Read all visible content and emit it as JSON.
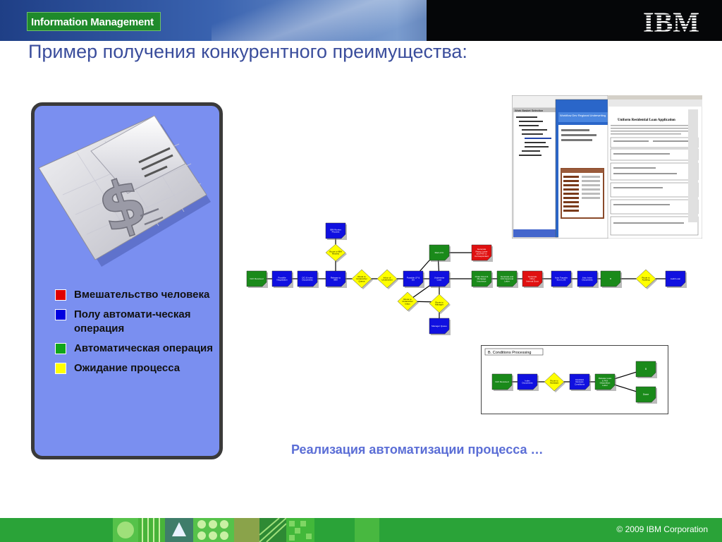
{
  "header": {
    "brand": "Information Management",
    "logo": "IBM"
  },
  "title": "Пример получения конкурентного преимущества:",
  "legend": [
    {
      "label": "Вмешательство человека",
      "color": "#e00000"
    },
    {
      "label": "Полу автомати-ческая операция",
      "color": "#0000e0"
    },
    {
      "label": "Автоматическая операция",
      "color": "#11a61a"
    },
    {
      "label": "Ожидание процесса",
      "color": "#ffff00"
    }
  ],
  "process": {
    "nodes": [
      {
        "label": "FAX Received",
        "color": "#1a8a1a"
      },
      {
        "label": "Possible Negotiation",
        "color": "#1010e0"
      },
      {
        "label": "OC & Index Documents",
        "color": "#1010e0"
      },
      {
        "label": "Release to IBM",
        "color": "#1010e0"
      },
      {
        "label": "Route to Underwriter Queue",
        "color": "#ffff00"
      },
      {
        "label": "Inbox of Underwriter",
        "color": "#ffff00"
      },
      {
        "label": "Possible LP & DU",
        "color": "#1010e0"
      },
      {
        "label": "Underwrite Loan",
        "color": "#1010e0"
      },
      {
        "label": "Order Flood & Mortgage Insurance",
        "color": "#1a8a1a"
      },
      {
        "label": "Generate and FAX Approval Letter",
        "color": "#1a8a1a"
      },
      {
        "label": "Generate Other Internal Docs",
        "color": "#e01010"
      },
      {
        "label": "Auto Transfer from LOS",
        "color": "#1010e0"
      },
      {
        "label": "Auto Index Documents",
        "color": "#1010e0"
      },
      {
        "label": "B",
        "color": "#1a8a1a"
      },
      {
        "label": "Route to Auditing",
        "color": "#ffff00"
      },
      {
        "label": "Audit Loan",
        "color": "#1010e0"
      },
      {
        "label": "IBM Worker Process",
        "color": "#1010e0"
      },
      {
        "label": "Route to IBM Review",
        "color": "#ffff00"
      },
      {
        "label": "Mail of IC",
        "color": "#1a8a1a"
      },
      {
        "label": "Generate Reject Letter and FAX to Correspondent",
        "color": "#e01010"
      },
      {
        "label": "Route to Underwriter Inbox",
        "color": "#ffff00"
      },
      {
        "label": "Route to Manager",
        "color": "#ffff00"
      },
      {
        "label": "Manager Queue",
        "color": "#1010e0"
      }
    ]
  },
  "conditions": {
    "title": "B. Conditions Processing",
    "nodes": [
      {
        "label": "FAX Received",
        "color": "#1a8a1a"
      },
      {
        "label": "Index Documents",
        "color": "#1010e0"
      },
      {
        "label": "Route to Assistant",
        "color": "#ffff00"
      },
      {
        "label": "Assistant Reviews Conditions",
        "color": "#1010e0"
      },
      {
        "label": "Release Loan & FAX Disposition Letter",
        "color": "#1a8a1a"
      },
      {
        "label": "B",
        "color": "#1a8a1a"
      },
      {
        "label": "Done",
        "color": "#1a8a1a"
      }
    ]
  },
  "screenshot": {
    "tree_title": "Work Basket Selection",
    "app_title": "Workflow Dev Regional Underwriting",
    "form_title": "Uniform Residential Loan Application"
  },
  "caption": "Реализация автоматизации процесса …",
  "footer": {
    "copyright": "© 2009  IBM Corporation"
  }
}
